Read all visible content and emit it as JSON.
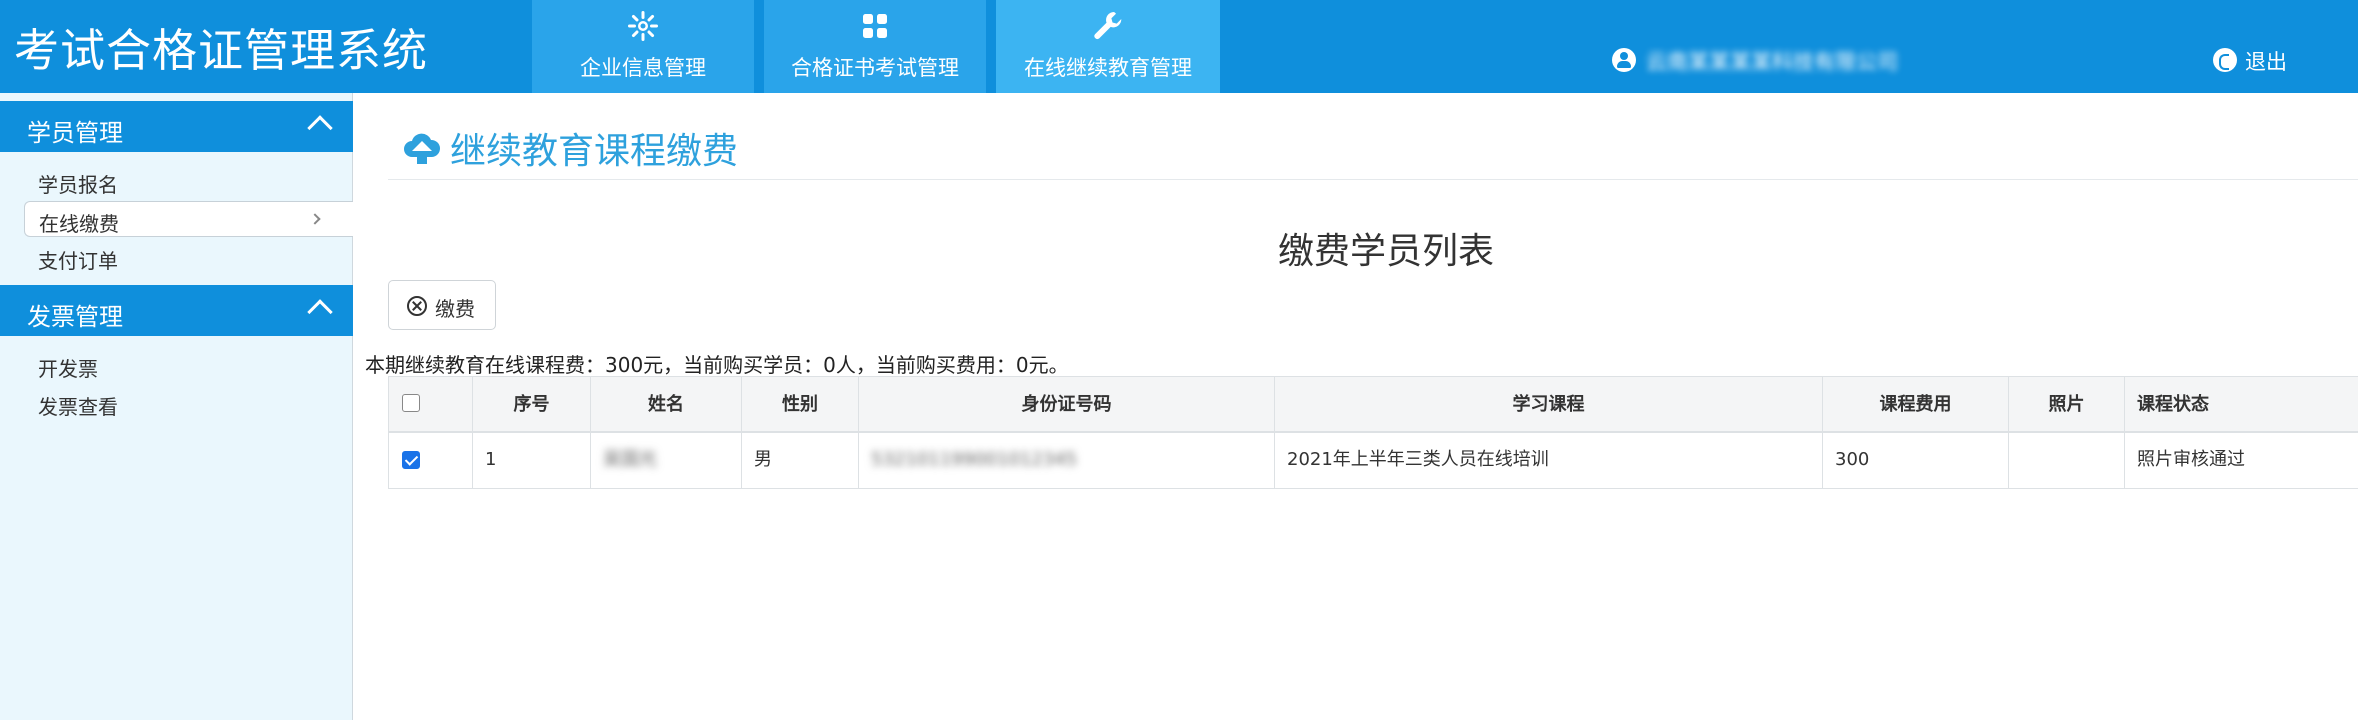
{
  "header": {
    "title": "考试合格证管理系统",
    "tabs": [
      {
        "label": "企业信息管理",
        "icon": "gear-icon"
      },
      {
        "label": "合格证书考试管理",
        "icon": "grid-icon"
      },
      {
        "label": "在线继续教育管理",
        "icon": "wrench-icon"
      }
    ],
    "user_name": "云南某某某某科技有限公司",
    "logout_label": "退出"
  },
  "sidebar": {
    "groups": [
      {
        "label": "学员管理",
        "items": [
          "学员报名",
          "在线缴费",
          "支付订单"
        ]
      },
      {
        "label": "发票管理",
        "items": [
          "开发票",
          "发票查看"
        ]
      }
    ]
  },
  "main": {
    "page_title": "继续教育课程缴费",
    "list_title": "缴费学员列表",
    "pay_button_label": "缴费",
    "summary": "本期继续教育在线课程费：300元，当前购买学员：0人，当前购买费用：0元。",
    "table": {
      "columns": [
        "序号",
        "姓名",
        "性别",
        "身份证号码",
        "学习课程",
        "课程费用",
        "照片",
        "课程状态"
      ],
      "rows": [
        {
          "checked": true,
          "index": "1",
          "name": "吴国光",
          "gender": "男",
          "id_number": "532101199001012345",
          "course": "2021年上半年三类人员在线培训",
          "fee": "300",
          "photo": "",
          "status": "照片审核通过"
        }
      ]
    }
  }
}
